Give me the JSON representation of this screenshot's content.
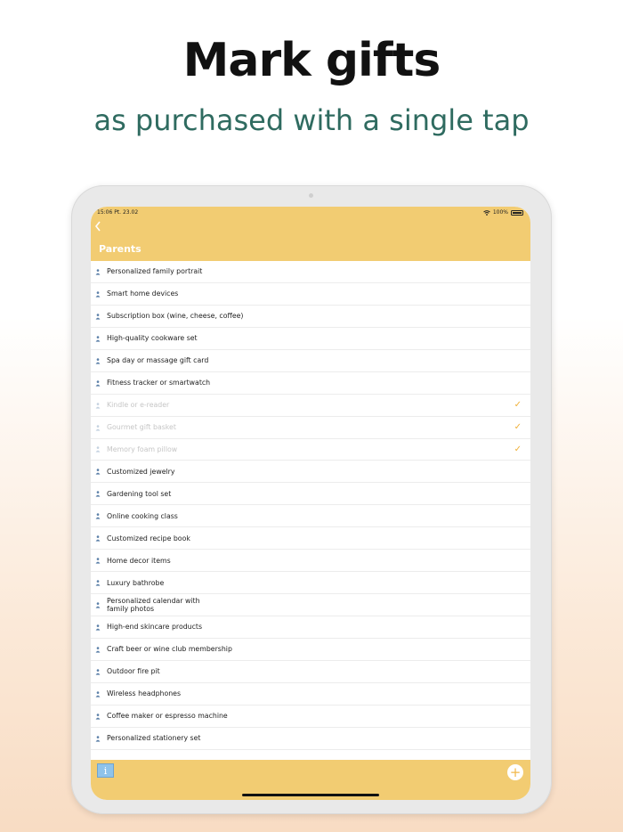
{
  "promo": {
    "headline": "Mark gifts",
    "subline": "as purchased with a single tap"
  },
  "status_bar": {
    "time": "15:06 Pt. 23.02",
    "battery": "100%"
  },
  "nav": {
    "back_icon": "chevron-left-icon",
    "title": "Parents"
  },
  "items": [
    {
      "label": "Personalized family portrait",
      "purchased": false
    },
    {
      "label": "Smart home devices",
      "purchased": false
    },
    {
      "label": "Subscription box (wine, cheese, coffee)",
      "purchased": false
    },
    {
      "label": "High-quality cookware set",
      "purchased": false
    },
    {
      "label": "Spa day or massage gift card",
      "purchased": false
    },
    {
      "label": "Fitness tracker or smartwatch",
      "purchased": false
    },
    {
      "label": "Kindle or e-reader",
      "purchased": true
    },
    {
      "label": "Gourmet gift basket",
      "purchased": true
    },
    {
      "label": "Memory foam pillow",
      "purchased": true
    },
    {
      "label": "Customized jewelry",
      "purchased": false
    },
    {
      "label": "Gardening tool set",
      "purchased": false
    },
    {
      "label": "Online cooking class",
      "purchased": false
    },
    {
      "label": "Customized recipe book",
      "purchased": false
    },
    {
      "label": "Home decor items",
      "purchased": false
    },
    {
      "label": "Luxury bathrobe",
      "purchased": false
    },
    {
      "label": "Personalized calendar with\nfamily photos",
      "purchased": false
    },
    {
      "label": "High-end skincare products",
      "purchased": false
    },
    {
      "label": "Craft beer or wine club membership",
      "purchased": false
    },
    {
      "label": "Outdoor fire pit",
      "purchased": false
    },
    {
      "label": "Wireless headphones",
      "purchased": false
    },
    {
      "label": "Coffee maker or espresso machine",
      "purchased": false
    },
    {
      "label": "Personalized stationery set",
      "purchased": false
    }
  ],
  "check_glyph": "✓",
  "toolbar": {
    "info_label": "i",
    "add_label": "+"
  },
  "colors": {
    "accent": "#f2cc72",
    "check": "#f0b13a",
    "subline": "#2f6b60"
  }
}
